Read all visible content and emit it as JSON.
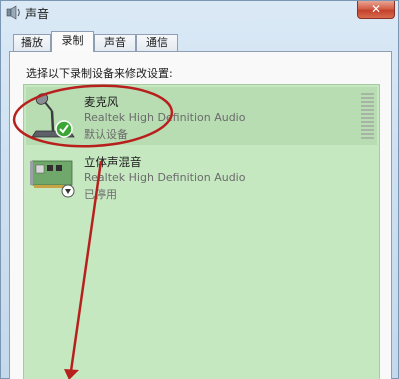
{
  "window": {
    "title": "声音",
    "close_label": "✕"
  },
  "tabs": [
    {
      "label": "播放",
      "active": false
    },
    {
      "label": "录制",
      "active": true
    },
    {
      "label": "声音",
      "active": false
    },
    {
      "label": "通信",
      "active": false
    }
  ],
  "panel": {
    "instruction": "选择以下录制设备来修改设置:"
  },
  "devices": [
    {
      "name": "麦克风",
      "driver": "Realtek High Definition Audio",
      "status": "默认设备",
      "icon": "microphone-icon",
      "badge": "checkmark-badge"
    },
    {
      "name": "立体声混音",
      "driver": "Realtek High Definition Audio",
      "status": "已停用",
      "icon": "sound-card-icon",
      "badge": "disabled-arrow-badge"
    }
  ],
  "colors": {
    "list_background": "#c6e8c1",
    "annotation": "#b8201e",
    "check_badge": "#3aa635"
  }
}
